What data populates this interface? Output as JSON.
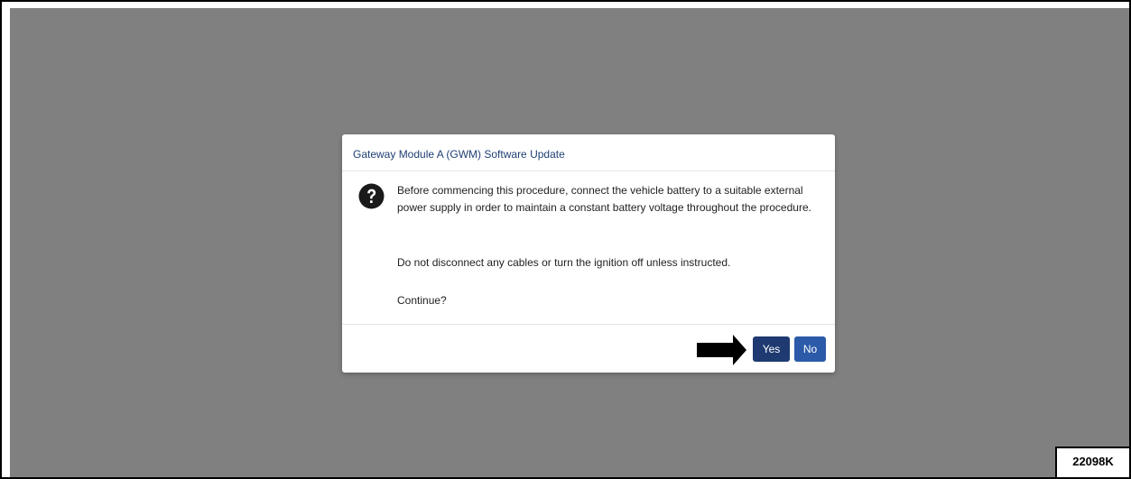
{
  "dialog": {
    "title": "Gateway Module A (GWM) Software Update",
    "icon": "question-circle-icon",
    "message_1": "Before commencing this procedure, connect the vehicle battery to a suitable external power supply in order to maintain a constant battery voltage throughout the procedure.",
    "message_2": "Do not disconnect any cables or turn the ignition off unless instructed.",
    "message_3": "Continue?",
    "yes_label": "Yes",
    "no_label": "No"
  },
  "annotation": {
    "arrow_icon": "right-arrow-icon",
    "figure_id": "22098K"
  },
  "colors": {
    "backdrop": "#808080",
    "title_text": "#1f3f74",
    "yes_button": "#1e3a70",
    "no_button": "#2b5aa8"
  }
}
